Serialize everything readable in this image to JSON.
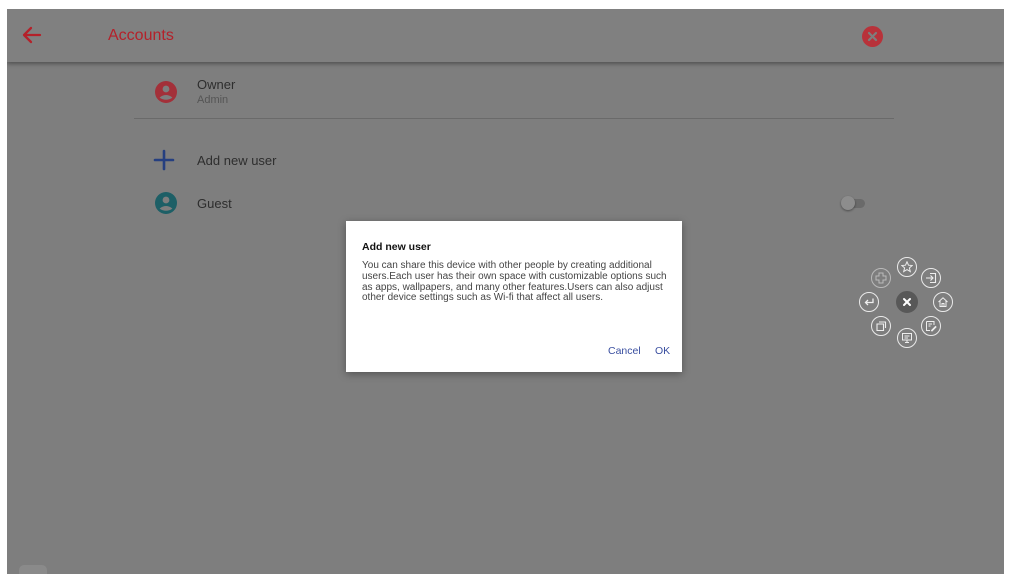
{
  "app": {
    "title": "Accounts"
  },
  "accounts": {
    "owner": {
      "name": "Owner",
      "role": "Admin"
    },
    "add_user_label": "Add new user",
    "guest": {
      "name": "Guest",
      "toggle_on": false
    }
  },
  "dialog": {
    "title": "Add new user",
    "body": "You can share this device with other people by creating additional users.Each user has their own space with customizable options such as apps, wallpapers, and many other features.Users can also adjust other device settings such as Wi-fi that affect all users.",
    "cancel_label": "Cancel",
    "ok_label": "OK"
  },
  "icons": {
    "back": "back-arrow-icon",
    "close": "close-circle-icon",
    "owner": "account-circle-icon",
    "add": "plus-icon",
    "guest": "account-circle-icon",
    "floating_menu": [
      "plus-icon",
      "star-icon",
      "input-icon",
      "return-icon",
      "close-icon",
      "home-icon",
      "window-icon",
      "screen-share-icon",
      "note-edit-icon"
    ]
  },
  "colors": {
    "accent": "#b4212a",
    "owner_icon": "#a33039",
    "add_icon": "#253f80",
    "guest_icon": "#1d5f66",
    "dialog_button": "#3a4fa0",
    "scrim_background": "#7e7e7e"
  }
}
